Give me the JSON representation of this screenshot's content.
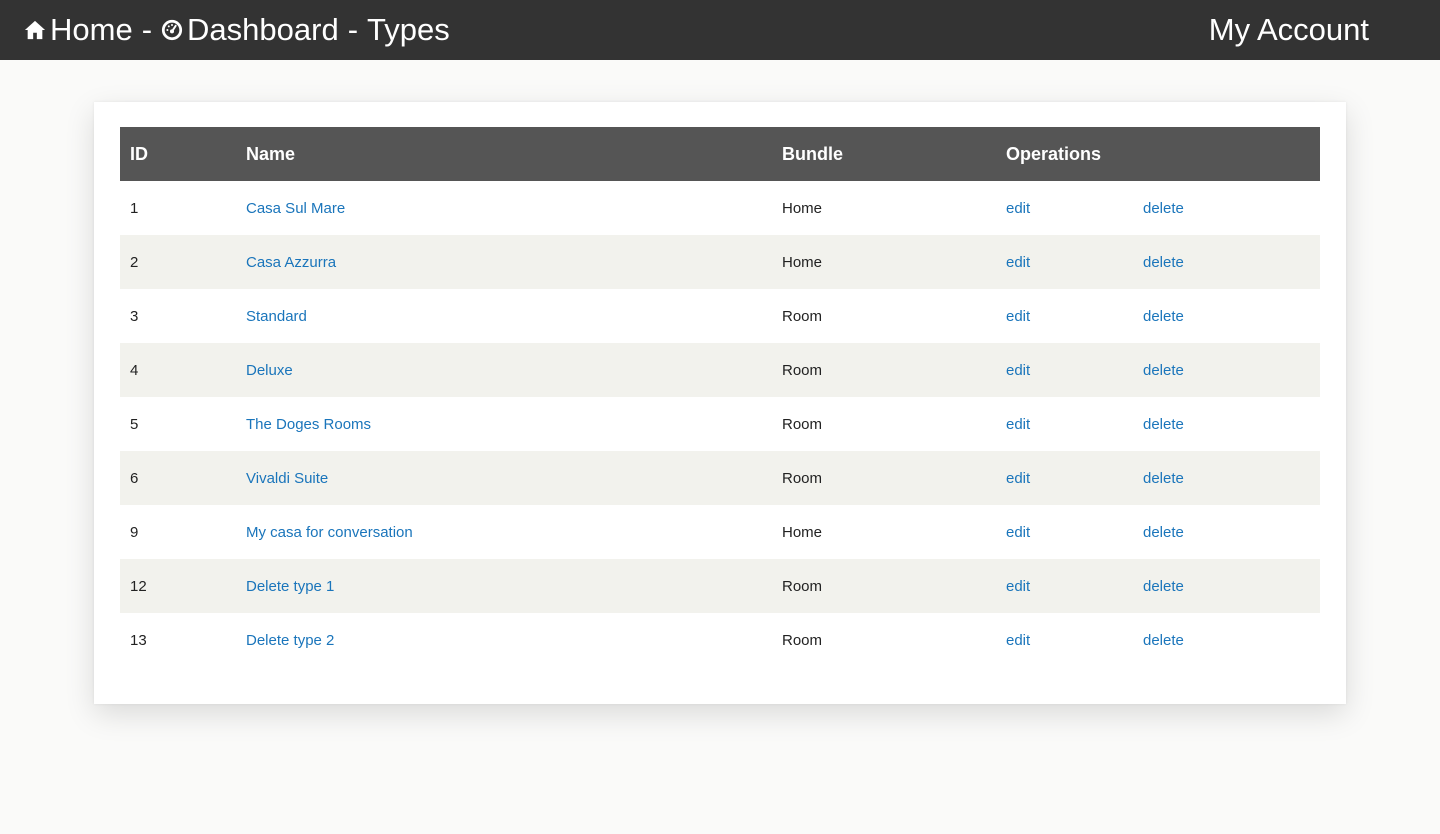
{
  "header": {
    "home_label": "Home",
    "separator_1": "-",
    "dashboard_label": "Dashboard",
    "separator_2": "-",
    "section_label": "Types",
    "account_label": "My Account",
    "home_icon": "home-icon",
    "dashboard_icon": "dashboard-gauge-icon"
  },
  "table": {
    "columns": {
      "id": "ID",
      "name": "Name",
      "bundle": "Bundle",
      "operations": "Operations"
    },
    "rows": [
      {
        "id": "1",
        "name": "Casa Sul Mare",
        "bundle": "Home",
        "edit": "edit",
        "delete": "delete"
      },
      {
        "id": "2",
        "name": "Casa Azzurra",
        "bundle": "Home",
        "edit": "edit",
        "delete": "delete"
      },
      {
        "id": "3",
        "name": "Standard",
        "bundle": "Room",
        "edit": "edit",
        "delete": "delete"
      },
      {
        "id": "4",
        "name": "Deluxe",
        "bundle": "Room",
        "edit": "edit",
        "delete": "delete"
      },
      {
        "id": "5",
        "name": "The Doges Rooms",
        "bundle": "Room",
        "edit": "edit",
        "delete": "delete"
      },
      {
        "id": "6",
        "name": "Vivaldi Suite",
        "bundle": "Room",
        "edit": "edit",
        "delete": "delete"
      },
      {
        "id": "9",
        "name": "My casa for conversation",
        "bundle": "Home",
        "edit": "edit",
        "delete": "delete"
      },
      {
        "id": "12",
        "name": "Delete type 1",
        "bundle": "Room",
        "edit": "edit",
        "delete": "delete"
      },
      {
        "id": "13",
        "name": "Delete type 2",
        "bundle": "Room",
        "edit": "edit",
        "delete": "delete"
      }
    ]
  },
  "colors": {
    "topbar": "#333333",
    "table_header": "#555555",
    "stripe": "#f2f2ed",
    "link": "#1a75bb",
    "page_background": "#fafaf9"
  }
}
